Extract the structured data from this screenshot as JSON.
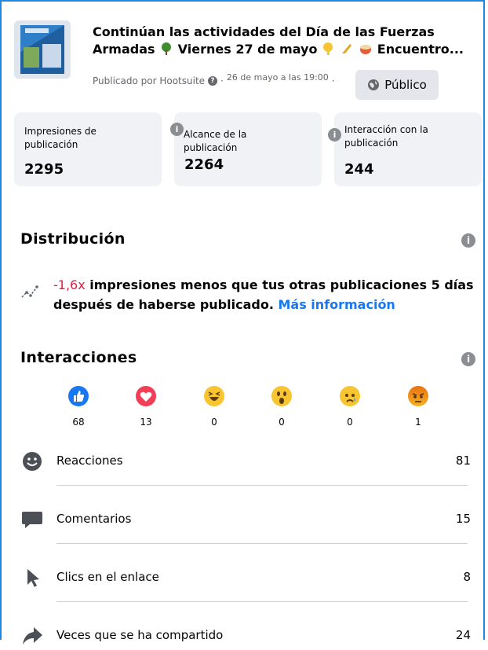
{
  "post": {
    "title_line1": "Continúan las actividades del Día de las Fuerzas",
    "title_line2_start": "Armadas",
    "title_line2_middle": "Viernes 27 de mayo",
    "title_line2_end": "Encuentro...",
    "published_by": "Publicado por Hootsuite",
    "date": "26 de mayo a las 19:00",
    "audience_label": "Público"
  },
  "metrics": [
    {
      "label": "Impresiones de publicación",
      "value": "2295"
    },
    {
      "label": "Alcance de la publicación",
      "value": "2264"
    },
    {
      "label": "Interacción con la publicación",
      "value": "244"
    }
  ],
  "distribution": {
    "title": "Distribución",
    "delta": "-1,6x",
    "text": " impresiones menos que tus otras publicaciones 5 días después de haberse publicado. ",
    "link": "Más información"
  },
  "interactions": {
    "title": "Interacciones",
    "reactions": [
      {
        "icon": "like-icon",
        "count": "68"
      },
      {
        "icon": "love-icon",
        "count": "13"
      },
      {
        "icon": "haha-icon",
        "count": "0"
      },
      {
        "icon": "wow-icon",
        "count": "0"
      },
      {
        "icon": "sad-icon",
        "count": "0"
      },
      {
        "icon": "angry-icon",
        "count": "1"
      }
    ],
    "rows": [
      {
        "icon": "smiley-icon",
        "label": "Reacciones",
        "value": "81"
      },
      {
        "icon": "comment-icon",
        "label": "Comentarios",
        "value": "15"
      },
      {
        "icon": "cursor-icon",
        "label": "Clics en el enlace",
        "value": "8"
      },
      {
        "icon": "share-icon",
        "label": "Veces que se ha compartido",
        "value": "24"
      }
    ]
  },
  "colors": {
    "accent": "#1877f2",
    "negative": "#e41e3f",
    "card_bg": "#f0f2f5",
    "frame": "#1e88e5"
  }
}
